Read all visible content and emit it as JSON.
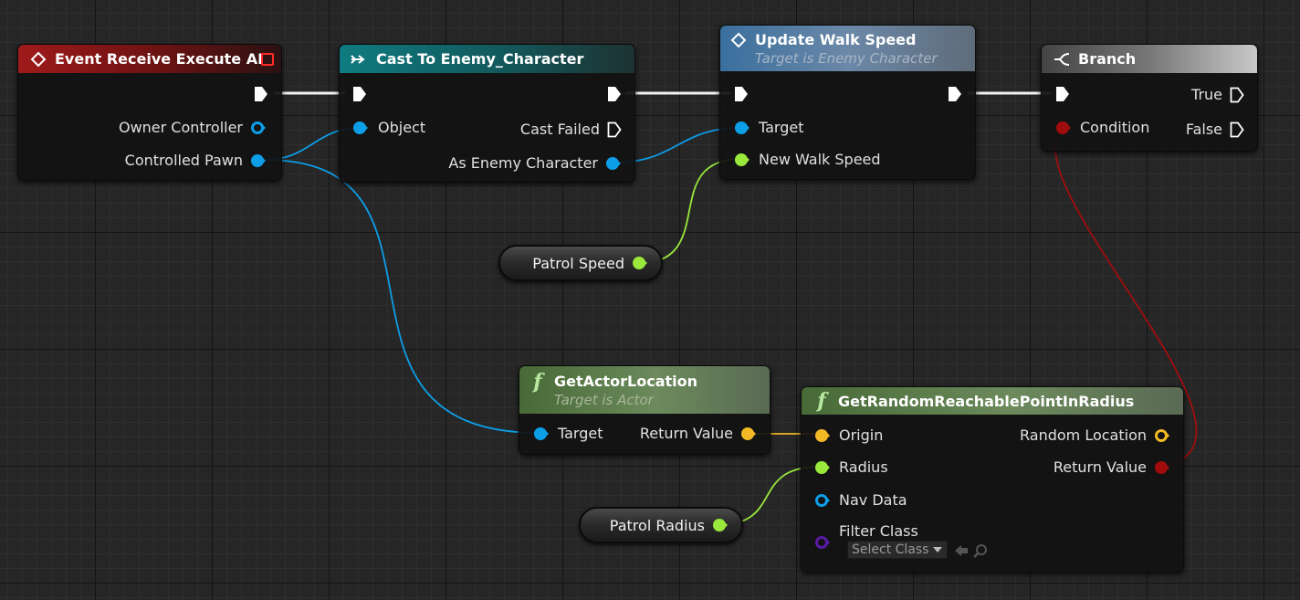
{
  "nodes": {
    "event_execute": {
      "title": "Event Receive Execute AI",
      "pins": {
        "owner_controller": "Owner Controller",
        "controlled_pawn": "Controlled Pawn"
      }
    },
    "cast_enemy": {
      "title": "Cast To Enemy_Character",
      "pins": {
        "object": "Object",
        "cast_failed": "Cast Failed",
        "as_enemy": "As Enemy Character"
      }
    },
    "update_walk_speed": {
      "title": "Update Walk Speed",
      "subtitle": "Target is Enemy Character",
      "pins": {
        "target": "Target",
        "new_walk_speed": "New Walk Speed"
      }
    },
    "branch": {
      "title": "Branch",
      "pins": {
        "true": "True",
        "condition": "Condition",
        "false": "False"
      }
    },
    "patrol_speed": {
      "label": "Patrol Speed"
    },
    "get_actor_location": {
      "title": "GetActorLocation",
      "subtitle": "Target is Actor",
      "pins": {
        "target": "Target",
        "return_value": "Return Value"
      }
    },
    "get_random_point": {
      "title": "GetRandomReachablePointInRadius",
      "pins": {
        "origin": "Origin",
        "random_location": "Random Location",
        "radius": "Radius",
        "return_value": "Return Value",
        "nav_data": "Nav Data",
        "filter_class": "Filter Class",
        "select_class": "Select Class"
      }
    },
    "patrol_radius": {
      "label": "Patrol Radius"
    }
  },
  "colors": {
    "exec": "#ffffff",
    "object": "#0d9ee8",
    "float": "#9ae83c",
    "vector": "#f2b927",
    "bool": "#a10d0d",
    "class": "#5a1aa8"
  }
}
